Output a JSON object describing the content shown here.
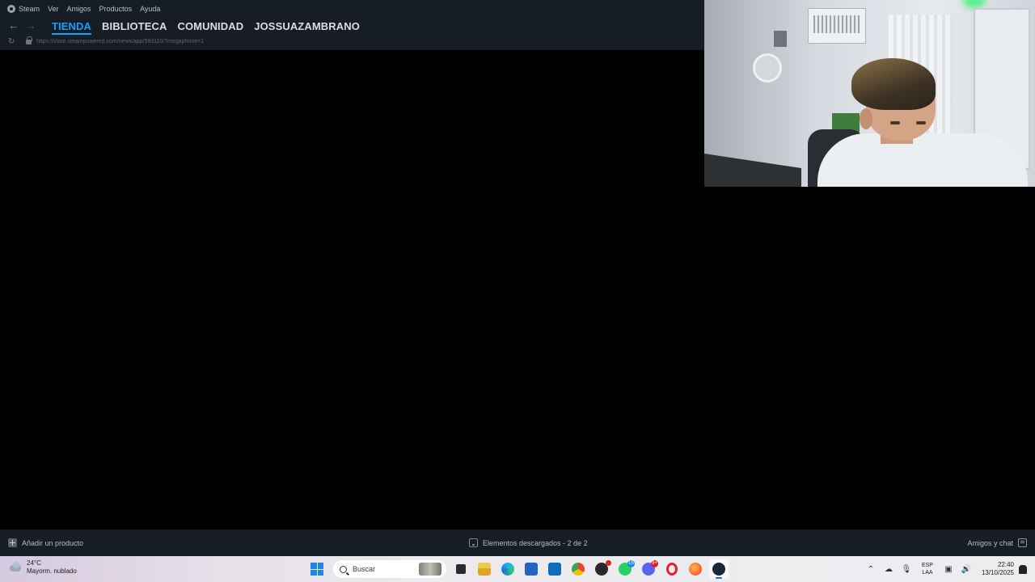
{
  "menubar": {
    "items": [
      "Steam",
      "Ver",
      "Amigos",
      "Productos",
      "Ayuda"
    ]
  },
  "nav": {
    "tabs": [
      "TIENDA",
      "BIBLIOTECA",
      "COMUNIDAD",
      "JOSSUAZAMBRANO"
    ],
    "active_tab": "TIENDA"
  },
  "url": "https://store.steampowered.com/news/app/593110/?megaphone=1",
  "bottombar": {
    "add_product": "Añadir un producto",
    "downloads": "Elementos descargados - 2 de 2",
    "friends": "Amigos y chat"
  },
  "taskbar": {
    "weather_temp": "24°C",
    "weather_desc": "Mayorm. nublado",
    "search_placeholder": "Buscar",
    "whatsapp_badge": "15",
    "discord_badge": "9+",
    "lang_top": "ESP",
    "lang_bottom": "LAA",
    "time": "22:40",
    "date": "13/10/2025"
  },
  "colors": {
    "accent": "#1a9fff",
    "chrome": "#171d25"
  }
}
